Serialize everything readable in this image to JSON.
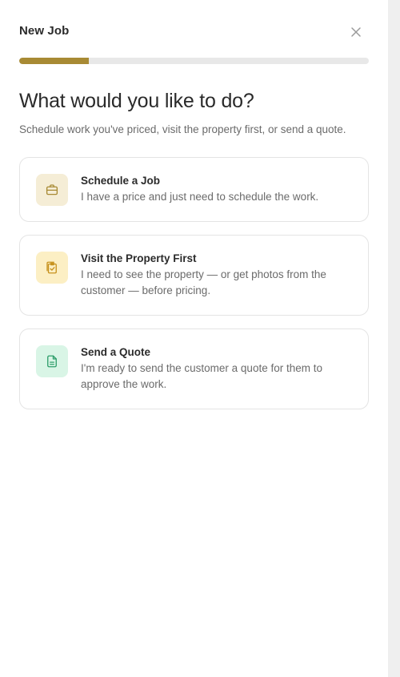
{
  "modal": {
    "title": "New Job",
    "close_label": "×",
    "progress_fraction": 0.2
  },
  "main": {
    "heading": "What would you like to do?",
    "subheading": "Schedule work you've priced, visit the property first, or send a quote."
  },
  "options": [
    {
      "title": "Schedule a Job",
      "description": "I have a price and just need to schedule the work.",
      "icon": "briefcase-icon",
      "icon_bg": "#f5edd6",
      "icon_color": "#a88a34"
    },
    {
      "title": "Visit the Property First",
      "description": "I need to see the property — or get photos from the customer — before pricing.",
      "icon": "clipboard-check-icon",
      "icon_bg": "#fcefc4",
      "icon_color": "#c7921e"
    },
    {
      "title": "Send a Quote",
      "description": "I'm ready to send the customer a quote for them to approve the work.",
      "icon": "document-icon",
      "icon_bg": "#d9f5e6",
      "icon_color": "#2f9e6b"
    }
  ]
}
